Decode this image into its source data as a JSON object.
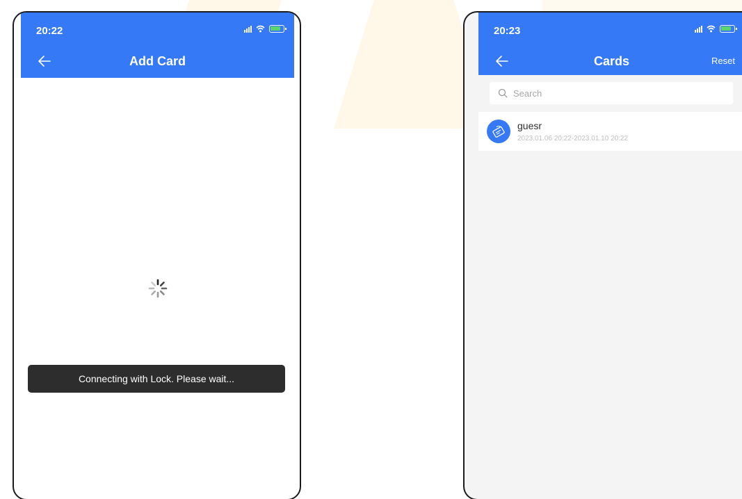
{
  "left_screen": {
    "status": {
      "time": "20:22"
    },
    "header": {
      "title": "Add Card"
    },
    "toast": "Connecting with Lock. Please wait..."
  },
  "right_screen": {
    "status": {
      "time": "20:23"
    },
    "header": {
      "title": "Cards",
      "reset_label": "Reset"
    },
    "search": {
      "placeholder": "Search"
    },
    "cards": [
      {
        "name": "guesr",
        "validity": "2023.01.06 20:22-2023.01.10 20:22"
      }
    ]
  },
  "colors": {
    "header": "#3579f6",
    "toast_bg": "#2d2d2d",
    "list_bg": "#f4f4f4"
  },
  "icons": [
    "back-arrow-icon",
    "signal-icon",
    "wifi-icon",
    "battery-icon",
    "loading-spinner-icon",
    "search-icon",
    "card-icon"
  ]
}
